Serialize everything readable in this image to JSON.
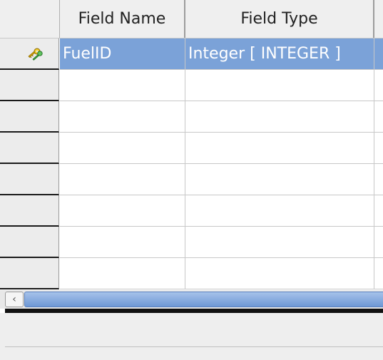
{
  "table_design": {
    "columns": [
      {
        "label": ""
      },
      {
        "label": "Field Name"
      },
      {
        "label": "Field Type"
      },
      {
        "label": ""
      }
    ],
    "rows": [
      {
        "field_name": "FuelID",
        "field_type": "Integer [ INTEGER ]",
        "primary_key": true,
        "selected": true
      },
      {
        "field_name": "",
        "field_type": "",
        "primary_key": false,
        "selected": false
      },
      {
        "field_name": "",
        "field_type": "",
        "primary_key": false,
        "selected": false
      },
      {
        "field_name": "",
        "field_type": "",
        "primary_key": false,
        "selected": false
      },
      {
        "field_name": "",
        "field_type": "",
        "primary_key": false,
        "selected": false
      },
      {
        "field_name": "",
        "field_type": "",
        "primary_key": false,
        "selected": false
      },
      {
        "field_name": "",
        "field_type": "",
        "primary_key": false,
        "selected": false
      },
      {
        "field_name": "",
        "field_type": "",
        "primary_key": false,
        "selected": false
      }
    ]
  },
  "icons": {
    "primary_key": "primary-key-icon",
    "scroll_left": "scroll-left-arrow-icon"
  },
  "colors": {
    "selection": "#7ba2d8",
    "header_bg": "#efefef",
    "scroll_thumb": "#7ba2d8"
  }
}
